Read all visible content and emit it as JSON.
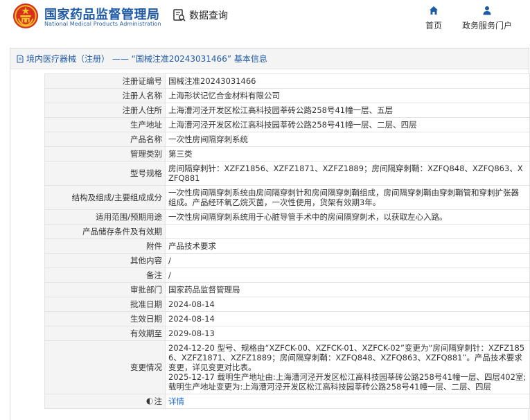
{
  "header": {
    "org_name_cn": "国家药品监督管理局",
    "org_name_en": "National Medical Products Administration",
    "query_label": "数据查询",
    "nav_home": "首页",
    "nav_portal": "政务服务门户"
  },
  "breadcrumb": {
    "text": "境内医疗器械（注册） —— “国械注准20243031466” 基本信息"
  },
  "record": [
    {
      "label": "注册证编号",
      "value": "国械注准20243031466"
    },
    {
      "label": "注册人名称",
      "value": "上海形状记忆合金材料有限公司"
    },
    {
      "label": "注册人住所",
      "value": "上海漕河泾开发区松江高科技园莘砖公路258号41幢一层、五层"
    },
    {
      "label": "生产地址",
      "value": "上海漕河泾开发区松江高科技园莘砖公路258号41幢一层、二层、四层"
    },
    {
      "label": "产品名称",
      "value": "一次性房间隔穿刺系统"
    },
    {
      "label": "管理类别",
      "value": "第三类"
    },
    {
      "label": "型号规格",
      "value": "房间隔穿刺针：XZFZ1856、XZFZ1871、XZFZ1889；房间隔穿刺鞘：XZFQ848、XZFQ863、XZFQ881"
    },
    {
      "label": "结构及组成/主要组成成分",
      "value": "一次性房间隔穿刺系统由房间隔穿刺针和房间隔穿刺鞘组成，房间隔穿刺鞘由穿刺鞘管和穿刺扩张器组成。产品经环氧乙烷灭菌，一次性使用，货架有效期3年。"
    },
    {
      "label": "适用范围/预期用途",
      "value": "一次性房间隔穿刺系统用于心脏导管手术中的房间隔穿刺术，以获取左心入路。"
    },
    {
      "label": "产品储存条件及有效期",
      "value": ""
    },
    {
      "label": "附件",
      "value": "产品技术要求"
    },
    {
      "label": "其他内容",
      "value": "/"
    },
    {
      "label": "备注",
      "value": "/"
    },
    {
      "label": "审批部门",
      "value": "国家药品监督管理局"
    },
    {
      "label": "批准日期",
      "value": "2024-08-14"
    },
    {
      "label": "生效日期",
      "value": "2024-08-14"
    },
    {
      "label": "有效期至",
      "value": "2029-08-13"
    }
  ],
  "change": {
    "label": "变更情况",
    "entry1": "2024-12-20 型号、规格由“XZFCK-00、XZFCK-01、XZFCK-02”变更为“房间隔穿刺针：XZFZ1856、XZFZ1871、XZFZ1889；房间隔穿刺鞘：XZFQ848、XZFQ863、XZFQ881”。产品技术要求变更，详见变更对比表。",
    "entry2": "2025-12-17 载明生产地址由:上海漕河泾开发区松江高科技园莘砖公路258号41幢一层、四层402室;载明生产地址变更为:上海漕河泾开发区松江高科技园莘砖公路258号41幢一层、二层、四层"
  },
  "note": {
    "label": "注",
    "link": "详情"
  },
  "colors": {
    "brand_blue": "#1f5aa6",
    "label_bg": "#f4f4f4",
    "link": "#1a66cc"
  }
}
